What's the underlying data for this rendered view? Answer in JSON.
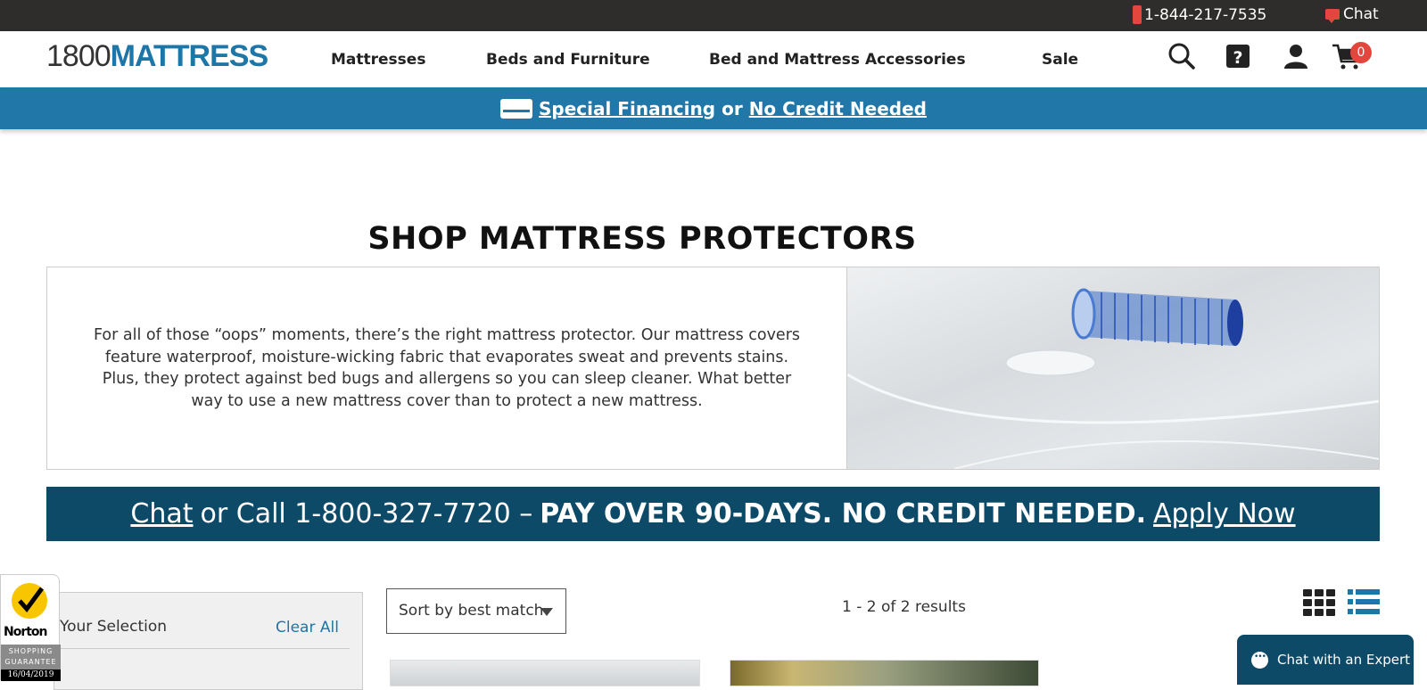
{
  "topbar": {
    "phone": "1-844-217-7535",
    "chat": "Chat"
  },
  "header": {
    "logo_thin": "1800",
    "logo_bold": "MATTRESS",
    "nav": [
      "Mattresses",
      "Beds and Furniture",
      "Bed and Mattress Accessories",
      "Sale"
    ],
    "cart_count": "0"
  },
  "promo": {
    "financing": "Special Financing",
    "or": "or",
    "no_credit": "No Credit Needed"
  },
  "page": {
    "title": "SHOP MATTRESS PROTECTORS",
    "intro": "For all of those “oops” moments, there’s the right mattress protector. Our mattress covers feature waterproof, moisture-wicking fabric that evaporates sweat and prevents stains. Plus, they protect against bed bugs and allergens so you can sleep cleaner. What better way to use a new mattress cover than to protect a new mattress."
  },
  "credit_bar": {
    "chat": "Chat",
    "call": "or Call 1-800-327-7720 –",
    "offer": "PAY OVER 90-DAYS. NO CREDIT NEEDED.",
    "apply": "Apply Now"
  },
  "norton": {
    "brand": "Norton",
    "guarantee": "SHOPPING GUARANTEE",
    "date": "16/04/2019"
  },
  "filters": {
    "label": "Your Selection",
    "clear": "Clear All"
  },
  "sort": {
    "value": "Sort by best match"
  },
  "results": {
    "text": "1 - 2 of 2 results"
  },
  "chat_widget": {
    "label": "Chat with an Expert"
  },
  "colors": {
    "brand_blue": "#1d76a8",
    "dark_navy": "#0d4a68",
    "accent_red": "#e2463d"
  }
}
